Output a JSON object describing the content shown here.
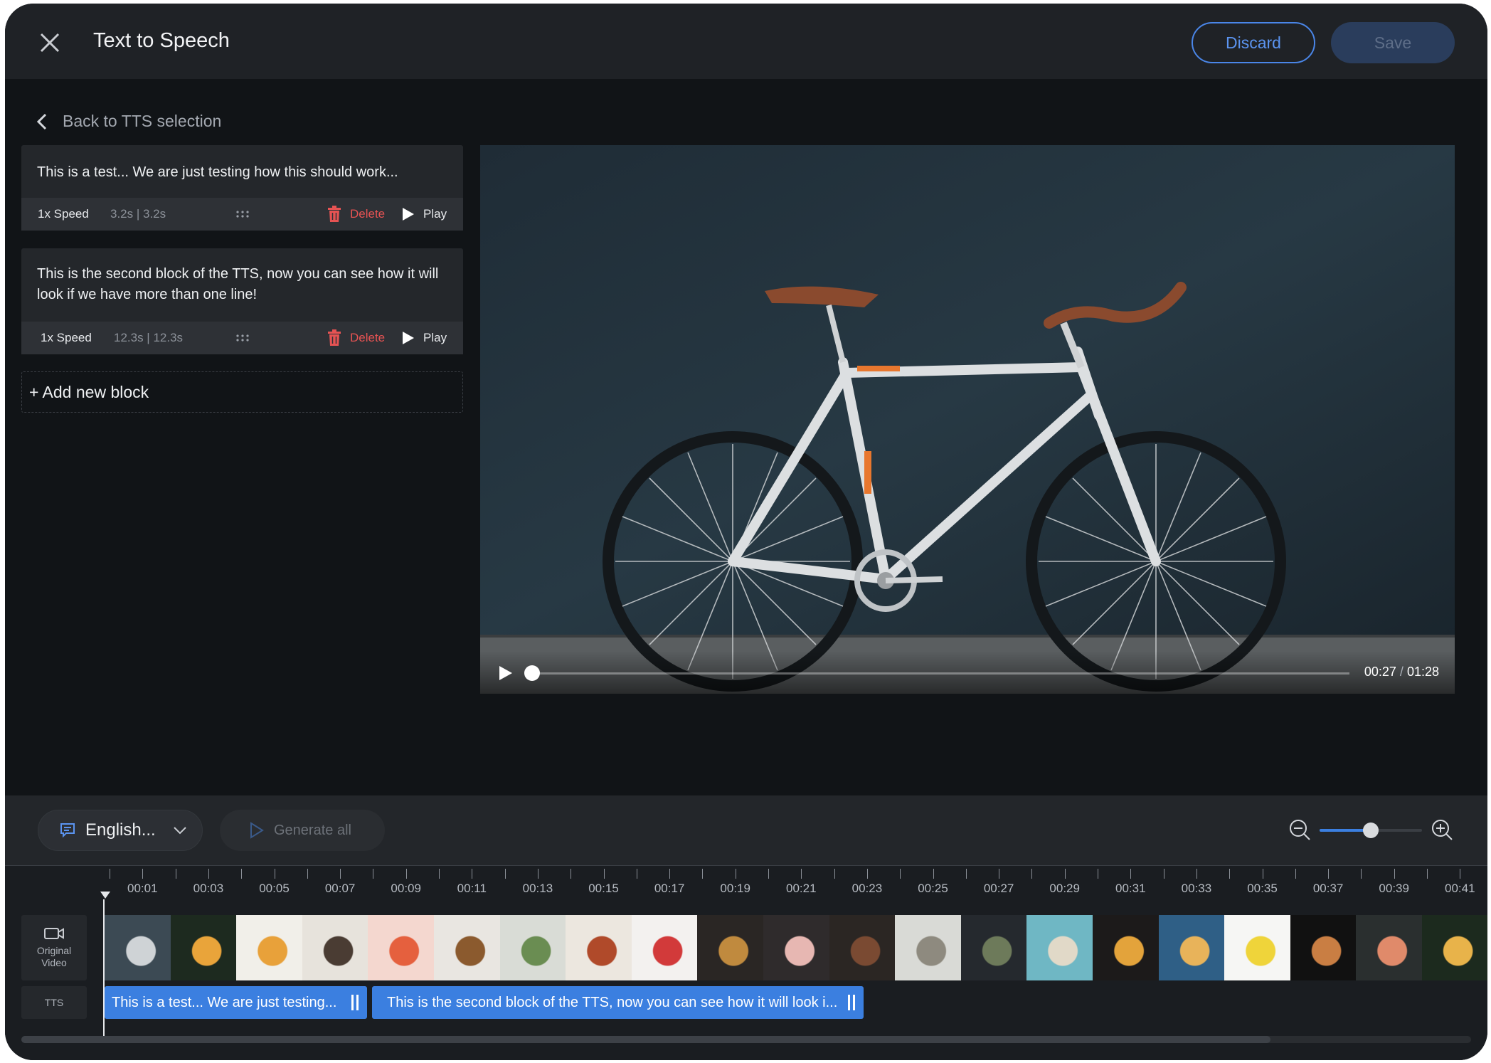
{
  "header": {
    "title": "Text to Speech",
    "discard_label": "Discard",
    "save_label": "Save"
  },
  "back_label": "Back to TTS selection",
  "blocks": [
    {
      "text": "This is a test... We are just testing how this should work...",
      "speed": "1x Speed",
      "duration": "3.2s | 3.2s",
      "delete_label": "Delete",
      "play_label": "Play"
    },
    {
      "text": "This is the second block of the TTS, now you can see how it will look if we have more than one line!",
      "speed": "1x Speed",
      "duration": "12.3s | 12.3s",
      "delete_label": "Delete",
      "play_label": "Play"
    }
  ],
  "add_block_label": "+ Add new block",
  "video": {
    "current_time": "00:27",
    "separator": "/",
    "total_time": "01:28",
    "progress": 0.0
  },
  "toolbar": {
    "language_label": "English...",
    "generate_label": "Generate all",
    "zoom_level": 0.5
  },
  "ruler": [
    "00:01",
    "00:03",
    "00:05",
    "00:07",
    "00:09",
    "00:11",
    "00:13",
    "00:15",
    "00:17",
    "00:19",
    "00:21",
    "00:23",
    "00:25",
    "00:27",
    "00:29",
    "00:31",
    "00:33",
    "00:35",
    "00:37",
    "00:39",
    "00:41"
  ],
  "tracks": {
    "video_label_line1": "Original",
    "video_label_line2": "Video",
    "tts_label": "TTS"
  },
  "clips": [
    {
      "text": "This is a test... We are just testing..."
    },
    {
      "text": "This is the second block of the TTS, now you can see how it will look i..."
    }
  ],
  "colors": {
    "accent": "#3b7fe0",
    "danger": "#e65353",
    "background": "#111417"
  }
}
